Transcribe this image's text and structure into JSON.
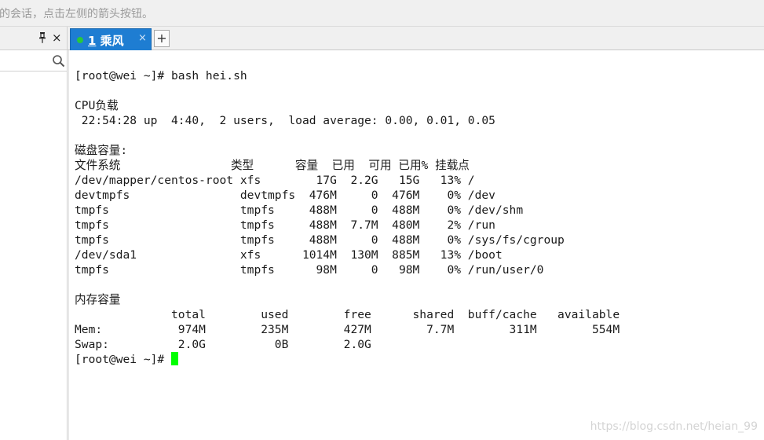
{
  "hint_bar": {
    "text": "的会话，点击左侧的箭头按钮。"
  },
  "left_pane": {
    "pin_icon": "pin-icon",
    "close_label": "×",
    "search_icon": "search-icon"
  },
  "tabs": [
    {
      "number": "1",
      "label": "乘风",
      "status_color": "#28c83c",
      "close_label": "×"
    }
  ],
  "new_tab_label": "+",
  "terminal": {
    "lines": [
      "[root@wei ~]# bash hei.sh",
      "",
      "CPU负载",
      " 22:54:28 up  4:40,  2 users,  load average: 0.00, 0.01, 0.05",
      "",
      "磁盘容量:",
      "文件系统                类型      容量  已用  可用 已用% 挂载点",
      "/dev/mapper/centos-root xfs        17G  2.2G   15G   13% /",
      "devtmpfs                devtmpfs  476M     0  476M    0% /dev",
      "tmpfs                   tmpfs     488M     0  488M    0% /dev/shm",
      "tmpfs                   tmpfs     488M  7.7M  480M    2% /run",
      "tmpfs                   tmpfs     488M     0  488M    0% /sys/fs/cgroup",
      "/dev/sda1               xfs      1014M  130M  885M   13% /boot",
      "tmpfs                   tmpfs      98M     0   98M    0% /run/user/0",
      "",
      "内存容量",
      "              total        used        free      shared  buff/cache   available",
      "Mem:           974M        235M        427M        7.7M        311M        554M",
      "Swap:          2.0G          0B        2.0G"
    ],
    "prompt": "[root@wei ~]# ",
    "cursor_color": "#00ff00"
  },
  "watermark": "https://blog.csdn.net/heian_99",
  "colors": {
    "tab_active": "#1e7dd2",
    "chrome_bg": "#f0f0f0",
    "terminal_bg": "#ffffff"
  }
}
